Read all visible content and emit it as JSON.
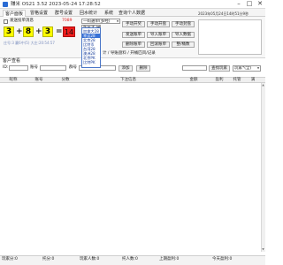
{
  "window": {
    "title": "赚米 OS21 3.52  2023-05-24 17:28:52",
    "minimize": "–",
    "maximize": "□",
    "close": "✕"
  },
  "tabs": [
    {
      "label": "客户面板"
    },
    {
      "label": "冒格设置"
    },
    {
      "label": "群号设置"
    },
    {
      "label": "回水统计"
    },
    {
      "label": "系统"
    },
    {
      "label": "查询个人数据"
    }
  ],
  "panel": {
    "checkbox_label": "发送投单消息",
    "top_number": "7089",
    "expr": {
      "a": "3",
      "plus1": "+",
      "b": "8",
      "plus2": "+",
      "c": "3",
      "equals": "=",
      "result": "14"
    },
    "status_text": "庄号:3 赢6中(5)  大庄:20:54:57",
    "date_text": "2023年05月24日14时51分9秒",
    "mode_dropdown": "一码通单(多经)",
    "odds_dropdown": "加拿大28",
    "game_options": [
      "加拿大28",
      "幸运28",
      "北京28",
      "比特币",
      "台湾28",
      "澳洲28",
      "北京PK",
      "比特PK"
    ],
    "buttons": {
      "auto_copy": "手动开奖",
      "manual_open": "手动开盘",
      "manual_stop": "手动封盘",
      "send_list": "发送账单",
      "import_list": "导入账单",
      "import_data": "导入数据",
      "delete_list": "删除账单",
      "fix_data": "回滚账单",
      "fix_report": "整/桶数"
    },
    "sub_note": "计 / 导账盘料 / 开桶匹风/记录"
  },
  "customer_search": {
    "section_title": "客户查看",
    "name_label": "ID:",
    "account_label": "账号",
    "multiple_label": "群号",
    "add_button": "添加",
    "delete_button": "删除",
    "search_button": "查找玩家",
    "filter_dropdown": "玩家*(全)"
  },
  "table": {
    "headers": [
      "昵称",
      "账号",
      "分数",
      "下注信息",
      "金额",
      "盈利",
      "托管",
      "满"
    ]
  },
  "statusbar": {
    "player_count": "玩家分:0",
    "support_count": "托分:0",
    "players": "玩家人数:0",
    "supports": "托人数:0",
    "last_profit": "上期盈利:0",
    "today_profit": "今天盈利:0"
  }
}
